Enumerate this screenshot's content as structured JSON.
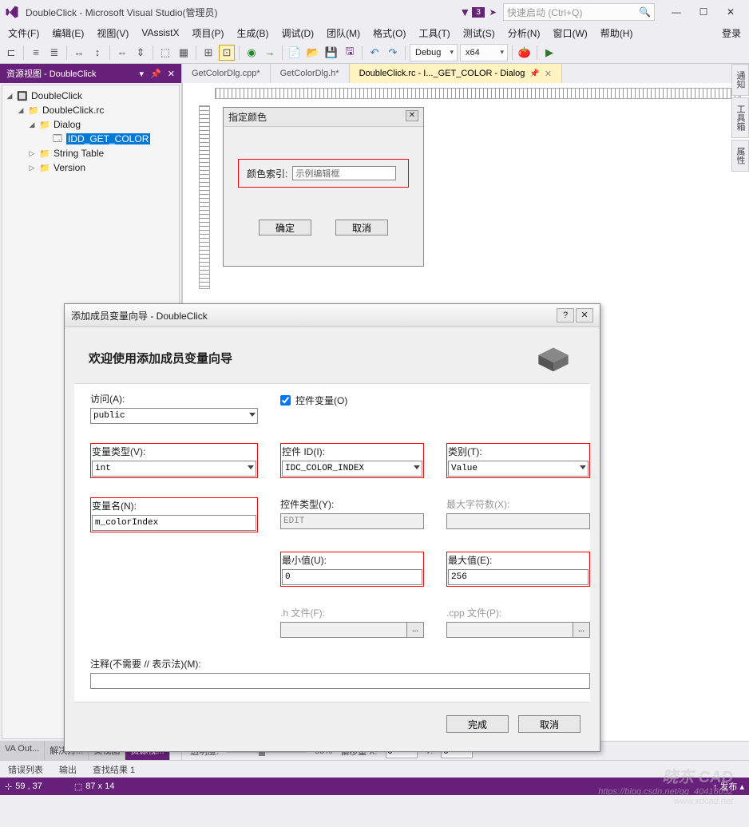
{
  "titlebar": {
    "title": "DoubleClick - Microsoft Visual Studio(管理员)",
    "badge": "3",
    "search_placeholder": "快速启动 (Ctrl+Q)"
  },
  "menubar": [
    "文件(F)",
    "编辑(E)",
    "视图(V)",
    "VAssistX",
    "项目(P)",
    "生成(B)",
    "调试(D)",
    "团队(M)",
    "格式(O)",
    "工具(T)",
    "测试(S)",
    "分析(N)",
    "窗口(W)",
    "帮助(H)",
    "登录"
  ],
  "toolbar": {
    "config": "Debug",
    "platform": "x64"
  },
  "left_panel": {
    "title": "资源视图 - DoubleClick",
    "tree": {
      "root": "DoubleClick",
      "rc": "DoubleClick.rc",
      "dialog": "Dialog",
      "dlg_id": "IDD_GET_COLOR",
      "string_table": "String Table",
      "version": "Version"
    },
    "tabs": [
      "VA Out...",
      "解决方...",
      "类视图",
      "资源视..."
    ]
  },
  "doc_tabs": [
    "GetColorDlg.cpp*",
    "GetColorDlg.h*",
    "DoubleClick.rc - I..._GET_COLOR - Dialog"
  ],
  "dlg_mock": {
    "title": "指定颜色",
    "label": "颜色索引:",
    "edit_placeholder": "示例编辑框",
    "ok": "确定",
    "cancel": "取消"
  },
  "wizard": {
    "title": "添加成员变量向导 - DoubleClick",
    "heading": "欢迎使用添加成员变量向导",
    "access_lbl": "访问(A):",
    "access_val": "public",
    "ctrl_var_lbl": "控件变量(O)",
    "var_type_lbl": "变量类型(V):",
    "var_type_val": "int",
    "var_name_lbl": "变量名(N):",
    "var_name_val": "m_colorIndex",
    "ctrl_id_lbl": "控件 ID(I):",
    "ctrl_id_val": "IDC_COLOR_INDEX",
    "ctrl_type_lbl": "控件类型(Y):",
    "ctrl_type_val": "EDIT",
    "min_lbl": "最小值(U):",
    "min_val": "0",
    "hfile_lbl": ".h 文件(F):",
    "category_lbl": "类别(T):",
    "category_val": "Value",
    "maxchars_lbl": "最大字符数(X):",
    "max_lbl": "最大值(E):",
    "max_val": "256",
    "cppfile_lbl": ".cpp 文件(P):",
    "comment_lbl": "注释(不需要 // 表示法)(M):",
    "finish": "完成",
    "cancel": "取消"
  },
  "editor_footer": {
    "opacity_lbl": "透明度:",
    "opacity_pct": "50%",
    "offset_x_lbl": "偏移量 X:",
    "offset_x": "0",
    "offset_y_lbl": "Y:",
    "offset_y": "0"
  },
  "right_tabs": [
    "通知",
    "工具箱",
    "属性"
  ],
  "output_tabs": [
    "错误列表",
    "输出",
    "查找结果 1"
  ],
  "statusbar": {
    "pos": "59 , 37",
    "size": "87 x 14",
    "publish": "↑ 发布 ▴"
  },
  "watermark": {
    "brand": "晓东 CAD",
    "url": "https://blog.csdn.net/qq_40416052",
    "site": "www.xdcad.net"
  }
}
